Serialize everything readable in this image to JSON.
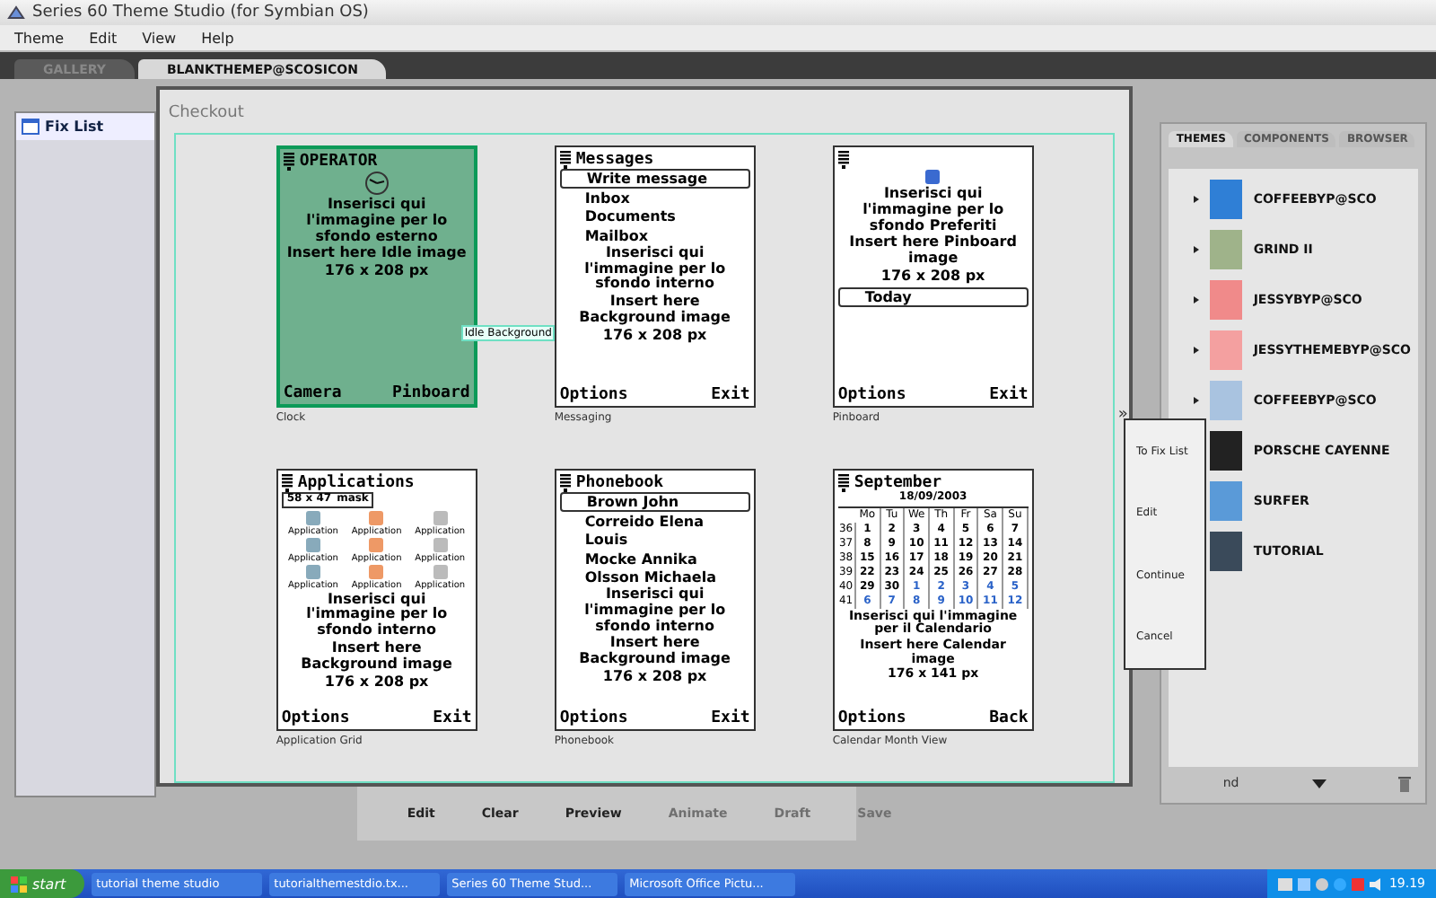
{
  "window": {
    "title": "Series 60 Theme Studio (for Symbian OS)"
  },
  "menu": [
    "Theme",
    "Edit",
    "View",
    "Help"
  ],
  "doc_tabs": [
    {
      "label": "GALLERY",
      "selected": false
    },
    {
      "label": "BLANKTHEMEP@SCOSICON",
      "selected": true
    }
  ],
  "fix_list": {
    "title": "Fix List"
  },
  "checkout": {
    "title": "Checkout",
    "more": "»",
    "tooltip": "Idle Background",
    "screens": [
      {
        "kind": "idle",
        "caption": "Clock",
        "selected": true,
        "title": "OPERATOR",
        "italian": "Inserisci qui l'immagine per lo sfondo esterno",
        "english": "Insert here Idle image",
        "size": "176 x 208 px",
        "left": "Camera",
        "right": "Pinboard"
      },
      {
        "kind": "list",
        "caption": "Messaging",
        "selected": false,
        "title": "Messages",
        "items": [
          {
            "label": "Write message",
            "selected": true
          },
          {
            "label": "Inbox",
            "selected": false
          },
          {
            "label": "Documents",
            "selected": false
          },
          {
            "label": "Mailbox",
            "selected": false
          }
        ],
        "italian": "Inserisci qui l'immagine per lo sfondo interno",
        "english": "Insert here Background image",
        "size": "176 x 208 px",
        "left": "Options",
        "right": "Exit"
      },
      {
        "kind": "pinboard",
        "caption": "Pinboard",
        "selected": false,
        "field": "Today",
        "italian": "Inserisci qui l'immagine per lo sfondo Preferiti",
        "english": "Insert here Pinboard image",
        "size": "176 x 208 px",
        "left": "Options",
        "right": "Exit"
      },
      {
        "kind": "grid",
        "caption": "Application Grid",
        "selected": false,
        "title": "Applications",
        "mask": [
          "58 x 47",
          "mask"
        ],
        "items": [
          "Application",
          "Application",
          "Application",
          "Application",
          "Application",
          "Application",
          "Application",
          "Application",
          "Application"
        ],
        "italian": "Inserisci qui l'immagine per lo sfondo interno",
        "english": "Insert here Background image",
        "size": "176 x 208 px",
        "left": "Options",
        "right": "Exit"
      },
      {
        "kind": "list",
        "caption": "Phonebook",
        "selected": false,
        "title": "Phonebook",
        "items": [
          {
            "label": "Brown John",
            "selected": true
          },
          {
            "label": "Correido Elena",
            "selected": false
          },
          {
            "label": "Louis",
            "selected": false
          },
          {
            "label": "Mocke Annika",
            "selected": false
          },
          {
            "label": "Olsson Michaela",
            "selected": false
          }
        ],
        "italian": "Inserisci qui l'immagine per lo sfondo interno",
        "english": "Insert here Background image",
        "size": "176 x 208 px",
        "left": "Options",
        "right": "Exit"
      },
      {
        "kind": "calendar",
        "caption": "Calendar Month View",
        "selected": false,
        "title": "September",
        "date": "18/09/2003",
        "weekdays": [
          "Mo",
          "Tu",
          "We",
          "Th",
          "Fr",
          "Sa",
          "Su"
        ],
        "weeks": [
          {
            "num": "36",
            "days": [
              "1",
              "2",
              "3",
              "4",
              "5",
              "6",
              "7"
            ]
          },
          {
            "num": "37",
            "days": [
              "8",
              "9",
              "10",
              "11",
              "12",
              "13",
              "14"
            ]
          },
          {
            "num": "38",
            "days": [
              "15",
              "16",
              "17",
              "18",
              "19",
              "20",
              "21"
            ]
          },
          {
            "num": "39",
            "days": [
              "22",
              "23",
              "24",
              "25",
              "26",
              "27",
              "28"
            ]
          },
          {
            "num": "40",
            "days": [
              "29",
              "30"
            ],
            "next_month_days": [
              "1",
              "2",
              "3",
              "4",
              "5"
            ]
          },
          {
            "num": "41",
            "next_month_days": [
              "6",
              "7",
              "8",
              "9",
              "10",
              "11",
              "12"
            ]
          }
        ],
        "italian": "Inserisci qui l'immagine per il Calendario",
        "english": "Insert here Calendar image",
        "size": "176 x 141 px",
        "left": "Options",
        "right": "Back"
      }
    ]
  },
  "toolbar": [
    {
      "label": "Edit",
      "disabled": false
    },
    {
      "label": "Clear",
      "disabled": false
    },
    {
      "label": "Preview",
      "disabled": false
    },
    {
      "label": "Animate",
      "disabled": true
    },
    {
      "label": "Draft",
      "disabled": true
    },
    {
      "label": "Save",
      "disabled": true
    }
  ],
  "themes_panel": {
    "tabs": [
      {
        "label": "THEMES",
        "selected": true
      },
      {
        "label": "COMPONENTS",
        "selected": false
      },
      {
        "label": "BROWSER",
        "selected": false
      }
    ],
    "themes": [
      {
        "name": "COFFEEBYP@SCO",
        "color": "#2f7fd6"
      },
      {
        "name": "GRIND II",
        "color": "#9fb38a"
      },
      {
        "name": "JESSYBYP@SCO",
        "color": "#f08a8a"
      },
      {
        "name": "JESSYTHEMEBYP@SCO",
        "color": "#f4a0a0"
      },
      {
        "name": "COFFEEBYP@SCO",
        "color": "#a9c3e0"
      },
      {
        "name": "PORSCHE CAYENNE",
        "color": "#222222"
      },
      {
        "name": "SURFER",
        "color": "#5a9ad8"
      },
      {
        "name": "TUTORIAL",
        "color": "#3a4a5a"
      }
    ],
    "footer": "nd"
  },
  "context_menu": [
    "To Fix List",
    "Edit",
    "Continue",
    "Cancel"
  ],
  "taskbar": {
    "start": "start",
    "tasks": [
      "tutorial theme studio",
      "tutorialthemestdio.tx...",
      "Series 60 Theme Stud...",
      "Microsoft Office Pictu..."
    ],
    "clock": "19.19"
  }
}
